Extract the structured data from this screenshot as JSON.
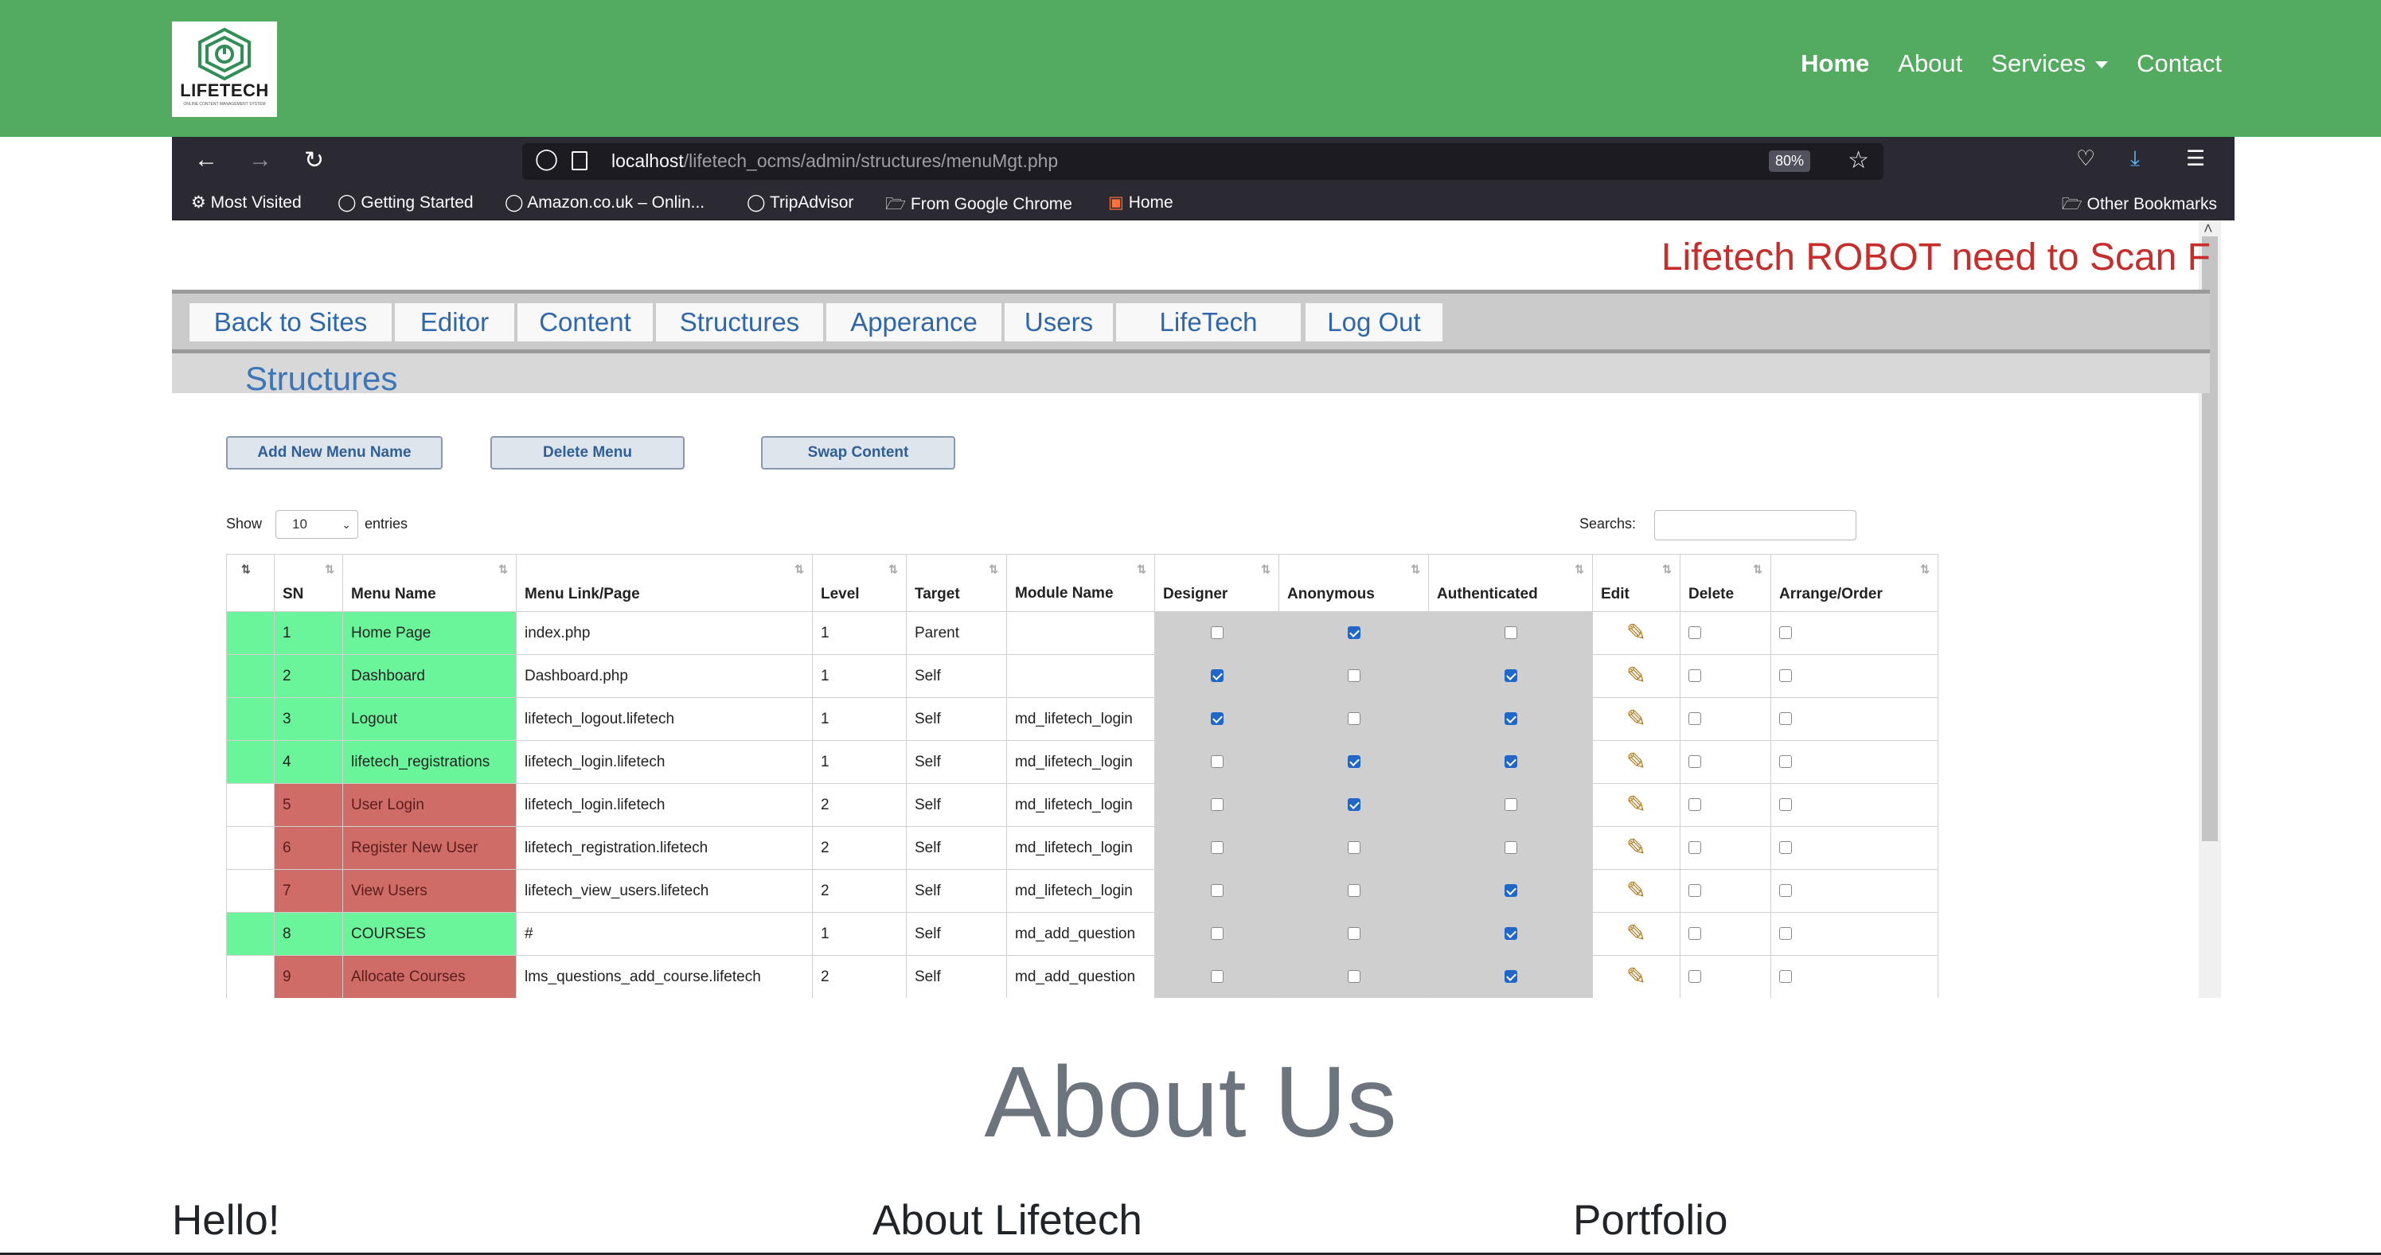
{
  "site": {
    "logo_text": "LIFETECH",
    "logo_subtitle": "ONLINE CONTENT MANAGEMENT SYSTEM",
    "nav": [
      {
        "label": "Home",
        "active": true
      },
      {
        "label": "About",
        "active": false
      },
      {
        "label": "Services",
        "active": false,
        "dropdown": true
      },
      {
        "label": "Contact",
        "active": false
      }
    ],
    "brand_color": "#53ab5f"
  },
  "browser": {
    "url_host": "localhost",
    "url_path": "/lifetech_ocms/admin/structures/menuMgt.php",
    "zoom": "80%",
    "bookmarks": [
      "Most Visited",
      "Getting Started",
      "Amazon.co.uk – Onlin...",
      "TripAdvisor",
      "From Google Chrome",
      "Home"
    ],
    "other_bookmarks": "Other Bookmarks"
  },
  "cms": {
    "marquee": "Lifetech ROBOT need to Scan F",
    "menu": [
      "Back to Sites",
      "Editor",
      "Content",
      "Structures",
      "Apperance",
      "Users",
      "LifeTech",
      "Log Out"
    ],
    "page_title": "Structures",
    "buttons": {
      "add": "Add New Menu Name",
      "delete": "Delete Menu",
      "swap": "Swap Content"
    },
    "show_label": "Show",
    "entries_value": "10",
    "entries_label": "entries",
    "search_label": "Searchs:",
    "columns": [
      "",
      "SN",
      "Menu Name",
      "Menu Link/Page",
      "Level",
      "Target",
      "Module Name",
      "Designer",
      "Anonymous",
      "Authenticated",
      "Edit",
      "Delete",
      "Arrange/Order"
    ],
    "rows": [
      {
        "sn": "1",
        "name": "Home Page",
        "link": "index.php",
        "level": "1",
        "target": "Parent",
        "module": "",
        "designer": false,
        "anonymous": true,
        "authenticated": false,
        "color": "green"
      },
      {
        "sn": "2",
        "name": "Dashboard",
        "link": "Dashboard.php",
        "level": "1",
        "target": "Self",
        "module": "",
        "designer": true,
        "anonymous": false,
        "authenticated": true,
        "color": "green"
      },
      {
        "sn": "3",
        "name": "Logout",
        "link": "lifetech_logout.lifetech",
        "level": "1",
        "target": "Self",
        "module": "md_lifetech_login",
        "designer": true,
        "anonymous": false,
        "authenticated": true,
        "color": "green"
      },
      {
        "sn": "4",
        "name": "lifetech_registrations",
        "link": "lifetech_login.lifetech",
        "level": "1",
        "target": "Self",
        "module": "md_lifetech_login",
        "designer": false,
        "anonymous": true,
        "authenticated": true,
        "color": "green"
      },
      {
        "sn": "5",
        "name": "User Login",
        "link": "lifetech_login.lifetech",
        "level": "2",
        "target": "Self",
        "module": "md_lifetech_login",
        "designer": false,
        "anonymous": true,
        "authenticated": false,
        "color": "red"
      },
      {
        "sn": "6",
        "name": "Register New User",
        "link": "lifetech_registration.lifetech",
        "level": "2",
        "target": "Self",
        "module": "md_lifetech_login",
        "designer": false,
        "anonymous": false,
        "authenticated": false,
        "color": "red"
      },
      {
        "sn": "7",
        "name": "View Users",
        "link": "lifetech_view_users.lifetech",
        "level": "2",
        "target": "Self",
        "module": "md_lifetech_login",
        "designer": false,
        "anonymous": false,
        "authenticated": true,
        "color": "red"
      },
      {
        "sn": "8",
        "name": "COURSES",
        "link": "#",
        "level": "1",
        "target": "Self",
        "module": "md_add_question",
        "designer": false,
        "anonymous": false,
        "authenticated": true,
        "color": "green"
      },
      {
        "sn": "9",
        "name": "Allocate Courses",
        "link": "lms_questions_add_course.lifetech",
        "level": "2",
        "target": "Self",
        "module": "md_add_question",
        "designer": false,
        "anonymous": false,
        "authenticated": true,
        "color": "red"
      }
    ]
  },
  "about": {
    "title": "About Us",
    "columns": [
      "Hello!",
      "About Lifetech",
      "Portfolio"
    ]
  }
}
